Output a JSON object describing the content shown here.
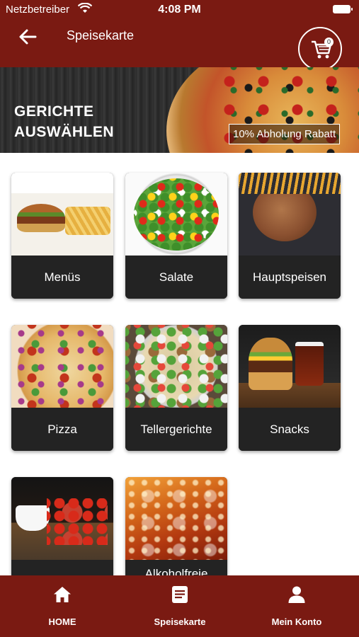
{
  "status_bar": {
    "carrier": "Netzbetreiber",
    "time": "4:08 PM"
  },
  "header": {
    "title": "Speisekarte",
    "cart_count": "0"
  },
  "banner": {
    "title_line1": "GERICHTE",
    "title_line2": "AUSWÄHLEN",
    "badge": "10% Abholung Rabatt"
  },
  "categories": [
    {
      "label": "Menüs"
    },
    {
      "label": "Salate"
    },
    {
      "label": "Hauptspeisen"
    },
    {
      "label": "Pizza"
    },
    {
      "label": "Tellergerichte"
    },
    {
      "label": "Snacks"
    },
    {
      "label": ""
    },
    {
      "label": "Alkoholfreie"
    }
  ],
  "tabbar": {
    "items": [
      {
        "label": "HOME",
        "icon": "home-icon"
      },
      {
        "label": "Speisekarte",
        "icon": "menu-book-icon"
      },
      {
        "label": "Mein Konto",
        "icon": "user-icon"
      }
    ]
  },
  "colors": {
    "brand": "#7a1a12",
    "card_label_bg": "#232323"
  }
}
